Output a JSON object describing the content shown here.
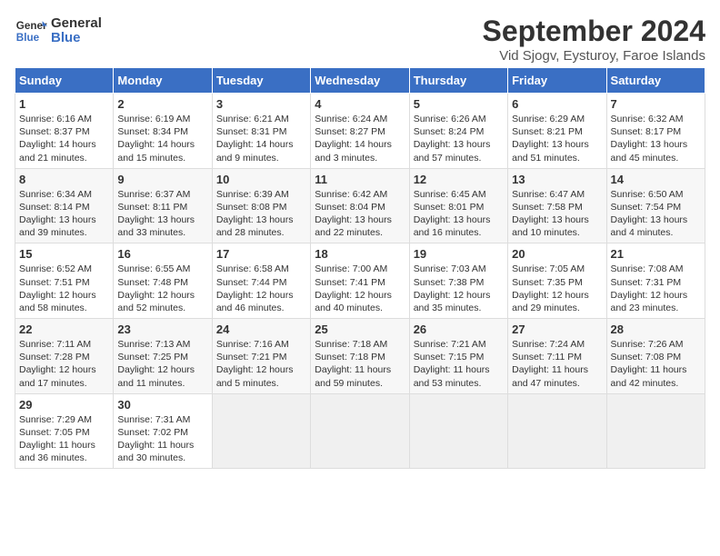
{
  "header": {
    "logo_line1": "General",
    "logo_line2": "Blue",
    "title": "September 2024",
    "subtitle": "Vid Sjogv, Eysturoy, Faroe Islands"
  },
  "columns": [
    "Sunday",
    "Monday",
    "Tuesday",
    "Wednesday",
    "Thursday",
    "Friday",
    "Saturday"
  ],
  "weeks": [
    [
      {
        "day": "1",
        "text": "Sunrise: 6:16 AM\nSunset: 8:37 PM\nDaylight: 14 hours\nand 21 minutes."
      },
      {
        "day": "2",
        "text": "Sunrise: 6:19 AM\nSunset: 8:34 PM\nDaylight: 14 hours\nand 15 minutes."
      },
      {
        "day": "3",
        "text": "Sunrise: 6:21 AM\nSunset: 8:31 PM\nDaylight: 14 hours\nand 9 minutes."
      },
      {
        "day": "4",
        "text": "Sunrise: 6:24 AM\nSunset: 8:27 PM\nDaylight: 14 hours\nand 3 minutes."
      },
      {
        "day": "5",
        "text": "Sunrise: 6:26 AM\nSunset: 8:24 PM\nDaylight: 13 hours\nand 57 minutes."
      },
      {
        "day": "6",
        "text": "Sunrise: 6:29 AM\nSunset: 8:21 PM\nDaylight: 13 hours\nand 51 minutes."
      },
      {
        "day": "7",
        "text": "Sunrise: 6:32 AM\nSunset: 8:17 PM\nDaylight: 13 hours\nand 45 minutes."
      }
    ],
    [
      {
        "day": "8",
        "text": "Sunrise: 6:34 AM\nSunset: 8:14 PM\nDaylight: 13 hours\nand 39 minutes."
      },
      {
        "day": "9",
        "text": "Sunrise: 6:37 AM\nSunset: 8:11 PM\nDaylight: 13 hours\nand 33 minutes."
      },
      {
        "day": "10",
        "text": "Sunrise: 6:39 AM\nSunset: 8:08 PM\nDaylight: 13 hours\nand 28 minutes."
      },
      {
        "day": "11",
        "text": "Sunrise: 6:42 AM\nSunset: 8:04 PM\nDaylight: 13 hours\nand 22 minutes."
      },
      {
        "day": "12",
        "text": "Sunrise: 6:45 AM\nSunset: 8:01 PM\nDaylight: 13 hours\nand 16 minutes."
      },
      {
        "day": "13",
        "text": "Sunrise: 6:47 AM\nSunset: 7:58 PM\nDaylight: 13 hours\nand 10 minutes."
      },
      {
        "day": "14",
        "text": "Sunrise: 6:50 AM\nSunset: 7:54 PM\nDaylight: 13 hours\nand 4 minutes."
      }
    ],
    [
      {
        "day": "15",
        "text": "Sunrise: 6:52 AM\nSunset: 7:51 PM\nDaylight: 12 hours\nand 58 minutes."
      },
      {
        "day": "16",
        "text": "Sunrise: 6:55 AM\nSunset: 7:48 PM\nDaylight: 12 hours\nand 52 minutes."
      },
      {
        "day": "17",
        "text": "Sunrise: 6:58 AM\nSunset: 7:44 PM\nDaylight: 12 hours\nand 46 minutes."
      },
      {
        "day": "18",
        "text": "Sunrise: 7:00 AM\nSunset: 7:41 PM\nDaylight: 12 hours\nand 40 minutes."
      },
      {
        "day": "19",
        "text": "Sunrise: 7:03 AM\nSunset: 7:38 PM\nDaylight: 12 hours\nand 35 minutes."
      },
      {
        "day": "20",
        "text": "Sunrise: 7:05 AM\nSunset: 7:35 PM\nDaylight: 12 hours\nand 29 minutes."
      },
      {
        "day": "21",
        "text": "Sunrise: 7:08 AM\nSunset: 7:31 PM\nDaylight: 12 hours\nand 23 minutes."
      }
    ],
    [
      {
        "day": "22",
        "text": "Sunrise: 7:11 AM\nSunset: 7:28 PM\nDaylight: 12 hours\nand 17 minutes."
      },
      {
        "day": "23",
        "text": "Sunrise: 7:13 AM\nSunset: 7:25 PM\nDaylight: 12 hours\nand 11 minutes."
      },
      {
        "day": "24",
        "text": "Sunrise: 7:16 AM\nSunset: 7:21 PM\nDaylight: 12 hours\nand 5 minutes."
      },
      {
        "day": "25",
        "text": "Sunrise: 7:18 AM\nSunset: 7:18 PM\nDaylight: 11 hours\nand 59 minutes."
      },
      {
        "day": "26",
        "text": "Sunrise: 7:21 AM\nSunset: 7:15 PM\nDaylight: 11 hours\nand 53 minutes."
      },
      {
        "day": "27",
        "text": "Sunrise: 7:24 AM\nSunset: 7:11 PM\nDaylight: 11 hours\nand 47 minutes."
      },
      {
        "day": "28",
        "text": "Sunrise: 7:26 AM\nSunset: 7:08 PM\nDaylight: 11 hours\nand 42 minutes."
      }
    ],
    [
      {
        "day": "29",
        "text": "Sunrise: 7:29 AM\nSunset: 7:05 PM\nDaylight: 11 hours\nand 36 minutes."
      },
      {
        "day": "30",
        "text": "Sunrise: 7:31 AM\nSunset: 7:02 PM\nDaylight: 11 hours\nand 30 minutes."
      },
      {
        "day": "",
        "text": ""
      },
      {
        "day": "",
        "text": ""
      },
      {
        "day": "",
        "text": ""
      },
      {
        "day": "",
        "text": ""
      },
      {
        "day": "",
        "text": ""
      }
    ]
  ]
}
